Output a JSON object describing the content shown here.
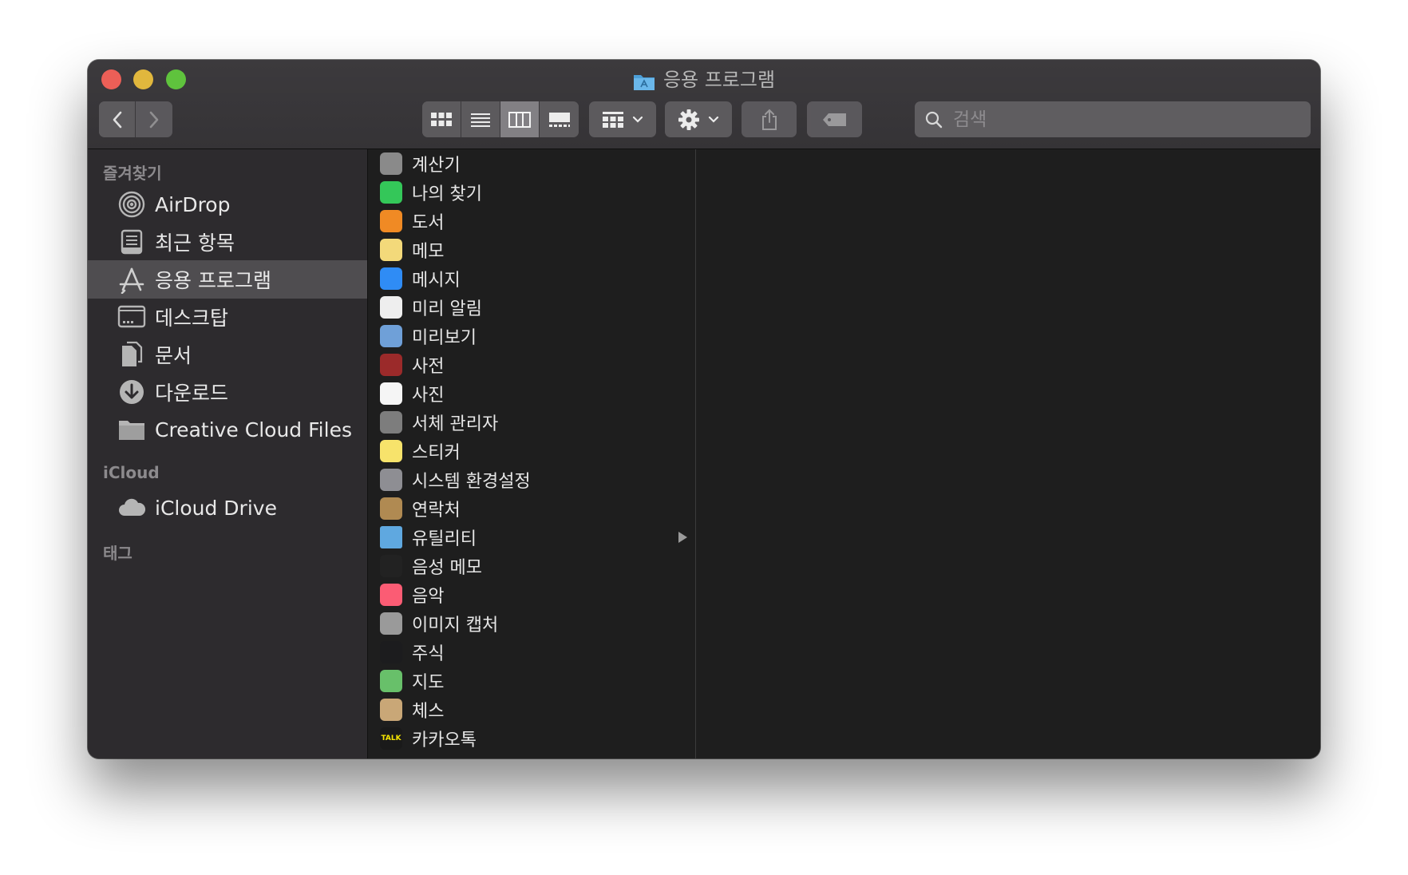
{
  "window": {
    "title": "응용 프로그램"
  },
  "toolbar": {
    "view_icons": [
      "icon-view-icon",
      "list-view-icon",
      "column-view-icon",
      "gallery-view-icon"
    ],
    "group_label": "group-menu",
    "action_label": "action-menu"
  },
  "search": {
    "placeholder": "검색"
  },
  "sidebar": {
    "favorites_header": "즐겨찾기",
    "favorites": [
      {
        "label": "AirDrop",
        "icon": "airdrop-icon"
      },
      {
        "label": "최근 항목",
        "icon": "recents-icon"
      },
      {
        "label": "응용 프로그램",
        "icon": "applications-icon",
        "selected": true
      },
      {
        "label": "데스크탑",
        "icon": "desktop-icon"
      },
      {
        "label": "문서",
        "icon": "documents-icon"
      },
      {
        "label": "다운로드",
        "icon": "downloads-icon"
      },
      {
        "label": "Creative Cloud Files",
        "icon": "folder-icon"
      }
    ],
    "icloud_header": "iCloud",
    "icloud": [
      {
        "label": "iCloud Drive",
        "icon": "cloud-icon"
      }
    ],
    "tags_header": "태그"
  },
  "files": [
    {
      "name": "계산기",
      "icon": "calculator-icon",
      "color": "#8a8a8a"
    },
    {
      "name": "나의 찾기",
      "icon": "findmy-icon",
      "color": "#34c759"
    },
    {
      "name": "도서",
      "icon": "books-icon",
      "color": "#f08a24"
    },
    {
      "name": "메모",
      "icon": "notes-icon",
      "color": "#f3d97a"
    },
    {
      "name": "메시지",
      "icon": "messages-icon",
      "color": "#2f8cf5"
    },
    {
      "name": "미리 알림",
      "icon": "reminders-icon",
      "color": "#eeeeee"
    },
    {
      "name": "미리보기",
      "icon": "preview-icon",
      "color": "#6fa0d8"
    },
    {
      "name": "사전",
      "icon": "dictionary-icon",
      "color": "#9b2a2a"
    },
    {
      "name": "사진",
      "icon": "photos-icon",
      "color": "#f5f5f5"
    },
    {
      "name": "서체 관리자",
      "icon": "fontbook-icon",
      "color": "#7d7d7d"
    },
    {
      "name": "스티커",
      "icon": "stickies-icon",
      "color": "#f7e36b"
    },
    {
      "name": "시스템 환경설정",
      "icon": "system-preferences-icon",
      "color": "#8e8e93"
    },
    {
      "name": "연락처",
      "icon": "contacts-icon",
      "color": "#b08a52"
    },
    {
      "name": "유틸리티",
      "icon": "utilities-folder-icon",
      "color": "#5fa8e0",
      "folder": true
    },
    {
      "name": "음성 메모",
      "icon": "voice-memos-icon",
      "color": "#222222"
    },
    {
      "name": "음악",
      "icon": "music-icon",
      "color": "#fb5c74"
    },
    {
      "name": "이미지 캡처",
      "icon": "image-capture-icon",
      "color": "#9a9a9a"
    },
    {
      "name": "주식",
      "icon": "stocks-icon",
      "color": "#1c1c1e"
    },
    {
      "name": "지도",
      "icon": "maps-icon",
      "color": "#68c06a"
    },
    {
      "name": "체스",
      "icon": "chess-icon",
      "color": "#c9a777"
    },
    {
      "name": "카카오톡",
      "icon": "kakaotalk-icon",
      "color": "#1a1a1a",
      "badge": "TALK"
    }
  ]
}
